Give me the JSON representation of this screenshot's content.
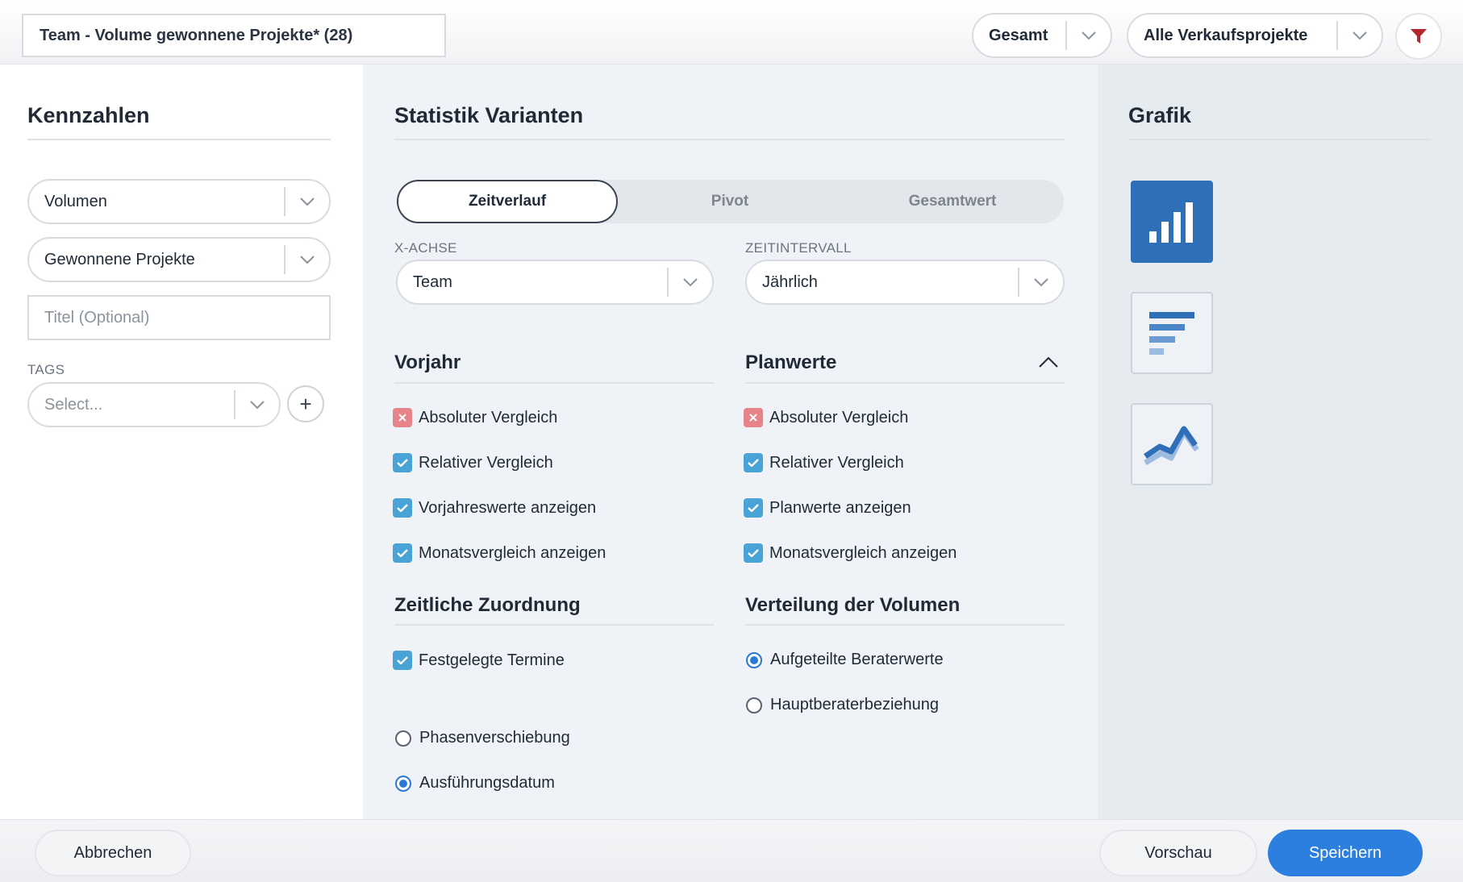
{
  "header": {
    "title_value": "Team - Volume gewonnene Projekte* (28)",
    "scope_select": "Gesamt",
    "projects_select": "Alle Verkaufsprojekte",
    "filter_icon": "funnel-icon",
    "filter_color": "#b3262d"
  },
  "left": {
    "heading": "Kennzahlen",
    "metric_select": "Volumen",
    "subject_select": "Gewonnene Projekte",
    "title_placeholder": "Titel (Optional)",
    "tags_label": "TAGS",
    "tags_placeholder": "Select...",
    "add_icon": "+"
  },
  "middle": {
    "heading": "Statistik Varianten",
    "tabs": [
      {
        "label": "Zeitverlauf",
        "active": true
      },
      {
        "label": "Pivot",
        "active": false
      },
      {
        "label": "Gesamtwert",
        "active": false
      }
    ],
    "x_axis_label": "X-ACHSE",
    "x_axis_value": "Team",
    "interval_label": "ZEITINTERVALL",
    "interval_value": "Jährlich",
    "vorjahr": {
      "heading": "Vorjahr",
      "items": [
        {
          "label": "Absoluter Vergleich",
          "state": "crossed"
        },
        {
          "label": "Relativer Vergleich",
          "state": "checked"
        },
        {
          "label": "Vorjahreswerte anzeigen",
          "state": "checked"
        },
        {
          "label": "Monatsvergleich anzeigen",
          "state": "checked"
        }
      ]
    },
    "planwerte": {
      "heading": "Planwerte",
      "items": [
        {
          "label": "Absoluter Vergleich",
          "state": "crossed"
        },
        {
          "label": "Relativer Vergleich",
          "state": "checked"
        },
        {
          "label": "Planwerte anzeigen",
          "state": "checked"
        },
        {
          "label": "Monatsvergleich anzeigen",
          "state": "checked"
        }
      ]
    },
    "zeitliche": {
      "heading": "Zeitliche Zuordnung",
      "checkbox": {
        "label": "Festgelegte Termine",
        "state": "checked"
      },
      "radios": [
        {
          "label": "Phasenverschiebung",
          "selected": false
        },
        {
          "label": "Ausführungsdatum",
          "selected": true
        }
      ]
    },
    "verteilung": {
      "heading": "Verteilung der Volumen",
      "radios": [
        {
          "label": "Aufgeteilte Beraterwerte",
          "selected": true
        },
        {
          "label": "Hauptberaterbeziehung",
          "selected": false
        }
      ]
    }
  },
  "right": {
    "heading": "Grafik",
    "chart_types": [
      {
        "icon": "column-chart-icon",
        "active": true
      },
      {
        "icon": "bar-chart-icon",
        "active": false
      },
      {
        "icon": "line-chart-icon",
        "active": false
      }
    ]
  },
  "footer": {
    "cancel_label": "Abbrechen",
    "preview_label": "Vorschau",
    "save_label": "Speichern"
  },
  "colors": {
    "primary": "#2c7fde",
    "checkbox": "#4aa3d6",
    "crossed": "#e6848a",
    "chart_tile_active": "#2f6fb7"
  }
}
